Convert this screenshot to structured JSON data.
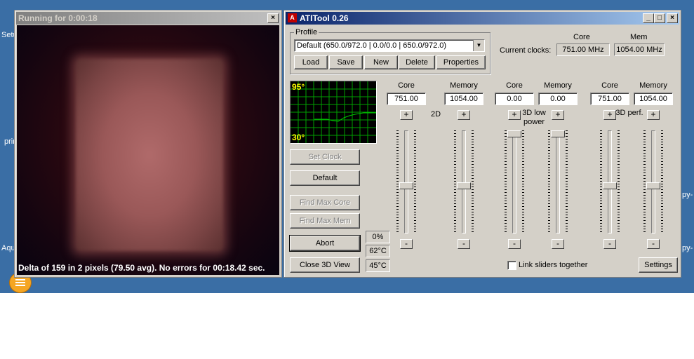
{
  "desktop": {
    "icon_labels": [
      "Setu",
      "prin",
      "Aqu",
      "py-",
      "py-"
    ]
  },
  "render_window": {
    "title": "Running for 0:00:18",
    "status": "Delta of 159 in 2 pixels (79.50 avg). No errors for 00:18.42 sec."
  },
  "ati": {
    "title": "ATITool 0.26",
    "profile": {
      "group_label": "Profile",
      "selected": "Default (650.0/972.0 | 0.0/0.0 | 650.0/972.0)",
      "buttons": {
        "load": "Load",
        "save": "Save",
        "new": "New",
        "delete": "Delete",
        "properties": "Properties"
      }
    },
    "clocks": {
      "label": "Current clocks:",
      "core_header": "Core",
      "mem_header": "Mem",
      "core_value": "751.00 MHz",
      "mem_value": "1054.00 MHz"
    },
    "temp_graph": {
      "max_label": "95°",
      "min_label": "30°"
    },
    "buttons": {
      "set_clock": "Set Clock",
      "default": "Default",
      "find_max_core": "Find Max Core",
      "find_max_mem": "Find Max Mem",
      "abort": "Abort",
      "close_3d": "Close 3D View",
      "settings": "Settings"
    },
    "readouts": {
      "percent": "0%",
      "temp1": "62°C",
      "temp2": "45°C"
    },
    "link_sliders_label": "Link sliders together",
    "link_sliders_checked": false,
    "profiles": [
      {
        "mode_label": "2D",
        "core_label": "Core",
        "memory_label": "Memory",
        "core": "751.00",
        "memory": "1054.00",
        "core_level": 0.45,
        "memory_level": 0.45
      },
      {
        "mode_label": "3D low power",
        "core_label": "Core",
        "memory_label": "Memory",
        "core": "0.00",
        "memory": "0.00",
        "core_level": 1.0,
        "memory_level": 1.0
      },
      {
        "mode_label": "3D perf.",
        "core_label": "Core",
        "memory_label": "Memory",
        "core": "751.00",
        "memory": "1054.00",
        "core_level": 0.45,
        "memory_level": 0.45
      }
    ],
    "plus": "+",
    "minus": "-"
  },
  "colors": {
    "title_active": "#0a246a",
    "graph_bg": "#000000",
    "graph_grid": "#00a000",
    "graph_line": "#00c800"
  }
}
